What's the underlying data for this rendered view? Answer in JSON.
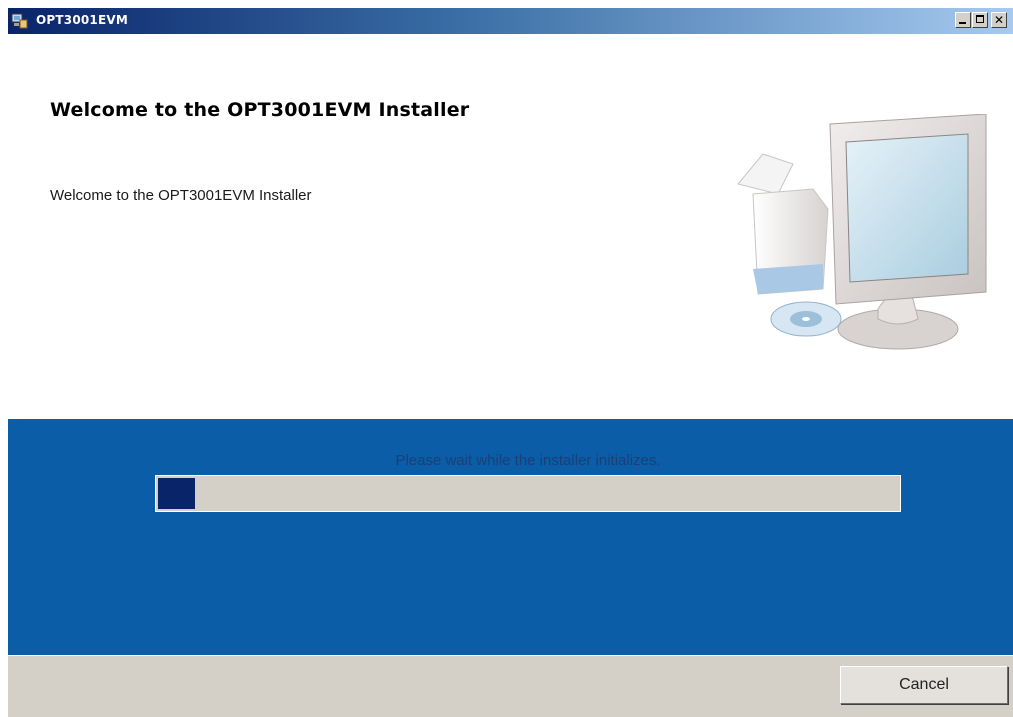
{
  "window": {
    "title": "OPT3001EVM",
    "controls": {
      "minimize": "_",
      "maximize": "□",
      "close": "✕"
    }
  },
  "welcome": {
    "heading": "Welcome to the OPT3001EVM Installer",
    "body": "Welcome to the OPT3001EVM Installer",
    "illustration_icon": "computer-install-icon"
  },
  "status": {
    "message": "Please wait while the installer initializes.",
    "progress_percent": 5
  },
  "footer": {
    "cancel_label": "Cancel"
  },
  "colors": {
    "status_background": "#0a5da6",
    "progress_fill": "#0a246a",
    "titlebar_start": "#0a246a"
  }
}
